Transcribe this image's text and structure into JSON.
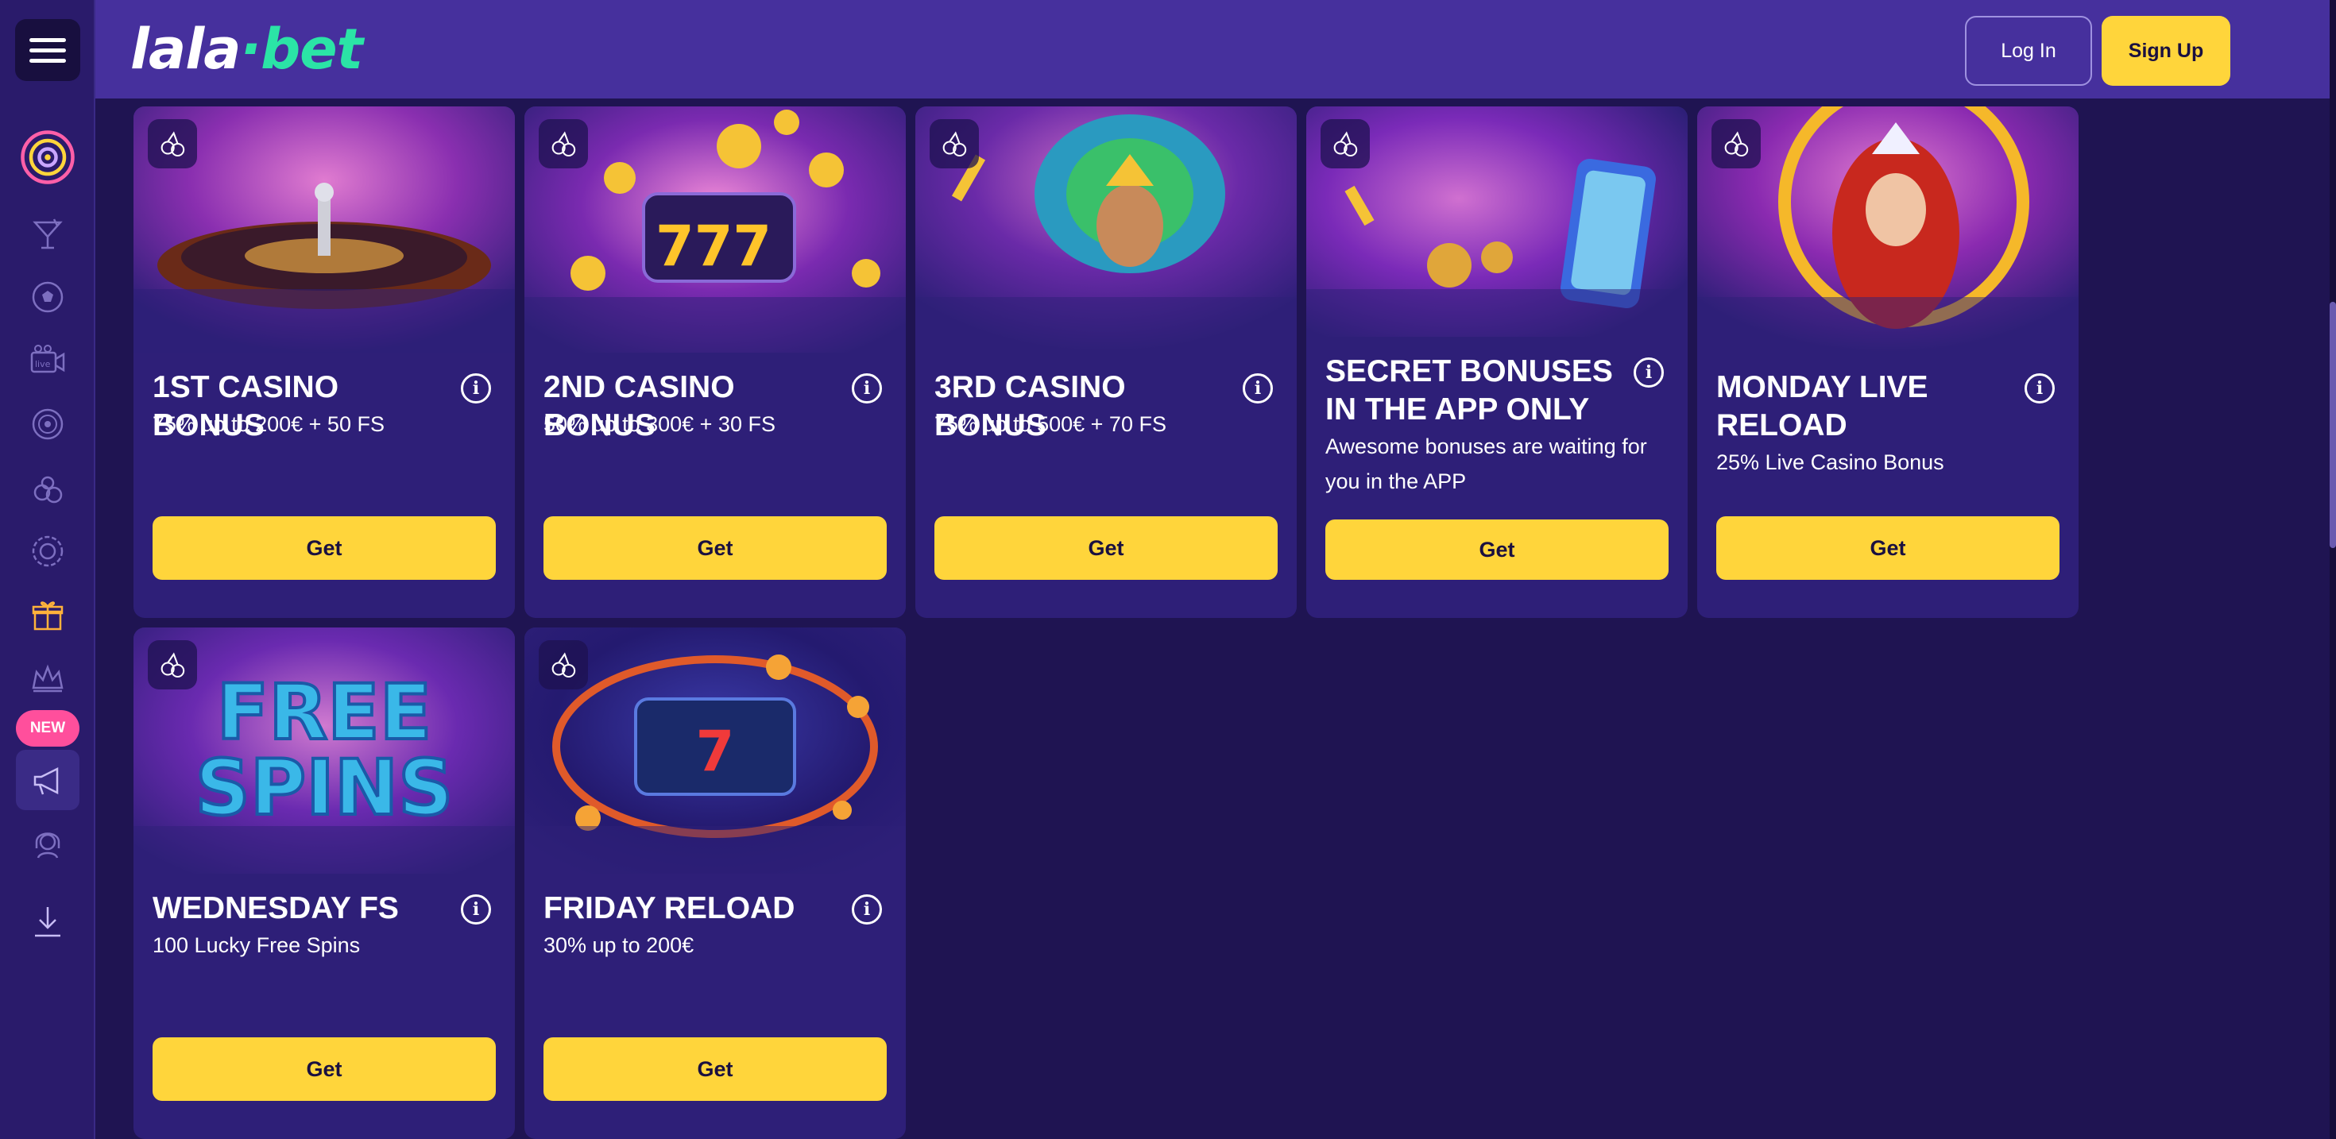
{
  "brand": {
    "logo_part1": "lala",
    "logo_dot": "·",
    "logo_part2": "bet"
  },
  "header": {
    "login_label": "Log In",
    "signup_label": "Sign Up"
  },
  "sidebar": {
    "items": [
      {
        "icon": "lalabet-target-icon"
      },
      {
        "icon": "cocktail-icon"
      },
      {
        "icon": "soccer-ball-icon"
      },
      {
        "icon": "live-camera-icon"
      },
      {
        "icon": "roulette-icon"
      },
      {
        "icon": "cherries-icon"
      },
      {
        "icon": "poker-chip-icon"
      },
      {
        "icon": "gift-icon"
      },
      {
        "icon": "crown-icon"
      },
      {
        "icon": "megaphone-icon"
      },
      {
        "icon": "support-headset-icon"
      },
      {
        "icon": "download-icon"
      }
    ],
    "new_badge": "NEW"
  },
  "bonuses": [
    {
      "title": "1ST CASINO BONUS",
      "subtitle": "75% up to 200€ + 50 FS",
      "button": "Get",
      "image": "roulette-wheel"
    },
    {
      "title": "2ND CASINO BONUS",
      "subtitle": "50% up to 300€ + 30 FS",
      "button": "Get",
      "image": "slot-777-coins"
    },
    {
      "title": "3RD CASINO BONUS",
      "subtitle": "75% up to 500€ + 70 FS",
      "button": "Get",
      "image": "carnival-dancer"
    },
    {
      "title": "SECRET BONUSES IN THE APP ONLY",
      "subtitle": "Awesome bonuses are waiting for you in the APP",
      "button": "Get",
      "image": "phone-app"
    },
    {
      "title": "MONDAY LIVE RELOAD",
      "subtitle": "25% Live Casino Bonus",
      "button": "Get",
      "image": "red-hair-queen"
    },
    {
      "title": "WEDNESDAY FS",
      "subtitle": "100 Lucky Free Spins",
      "button": "Get",
      "image": "free-spins-text",
      "image_text_1": "FREE",
      "image_text_2": "SPINS"
    },
    {
      "title": "FRIDAY RELOAD",
      "subtitle": "30% up to 200€",
      "button": "Get",
      "image": "slot-reels-fire"
    }
  ],
  "colors": {
    "background": "#1f1452",
    "sidebar": "#2a1b6b",
    "header": "#46309d",
    "card": "#2e1f78",
    "accent_yellow": "#ffd53b",
    "logo_green": "#2be4a6",
    "new_badge_pink": "#ff4f9c"
  }
}
